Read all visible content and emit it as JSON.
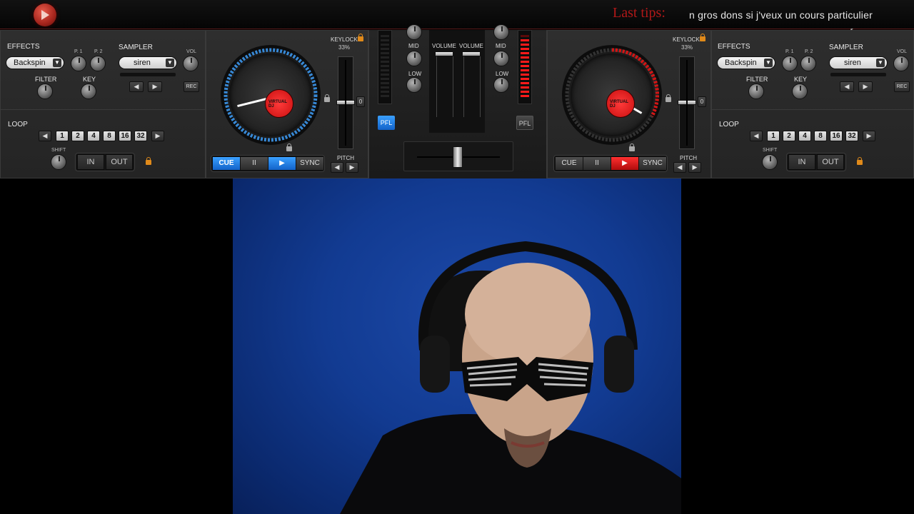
{
  "top_bar": {
    "logo_icon": "play-logo-icon",
    "tips_label": "Last tips:",
    "tips_text": "n gros dons si j'veux un cours particulier"
  },
  "left_deck": {
    "effects_label": "EFFECTS",
    "effect_value": "Backspin",
    "p1_label": "P. 1",
    "p2_label": "P. 2",
    "sampler_label": "SAMPLER",
    "sampler_value": "siren",
    "vol_label": "VOL",
    "filter_label": "FILTER",
    "key_label": "KEY",
    "rec_label": "REC",
    "loop_label": "LOOP",
    "loop_values": [
      "1",
      "2",
      "4",
      "8",
      "16",
      "32"
    ],
    "shift_label": "SHIFT",
    "in_label": "IN",
    "out_label": "OUT",
    "keylock_label": "KEYLOCK",
    "keylock_value": "33%",
    "pitch_label": "PITCH",
    "pitch_zero": "0",
    "cue_label": "CUE",
    "pause_label": "II",
    "sync_label": "SYNC",
    "turntable_logo": "VIRTUAL DJ",
    "ring_color": "#3a8fe0"
  },
  "right_deck": {
    "effects_label": "EFFECTS",
    "effect_value": "Backspin",
    "p1_label": "P. 1",
    "p2_label": "P. 2",
    "sampler_label": "SAMPLER",
    "sampler_value": "siren",
    "vol_label": "VOL",
    "filter_label": "FILTER",
    "key_label": "KEY",
    "rec_label": "REC",
    "loop_label": "LOOP",
    "loop_values": [
      "1",
      "2",
      "4",
      "8",
      "16",
      "32"
    ],
    "shift_label": "SHIFT",
    "in_label": "IN",
    "out_label": "OUT",
    "keylock_label": "KEYLOCK",
    "keylock_value": "33%",
    "pitch_label": "PITCH",
    "pitch_zero": "0",
    "cue_label": "CUE",
    "pause_label": "II",
    "sync_label": "SYNC",
    "turntable_logo": "VIRTUAL DJ",
    "ring_color": "#d41515"
  },
  "mixer": {
    "mid_label": "MID",
    "low_label": "LOW",
    "volume_label": "VOLUME",
    "pfl_label": "PFL"
  }
}
